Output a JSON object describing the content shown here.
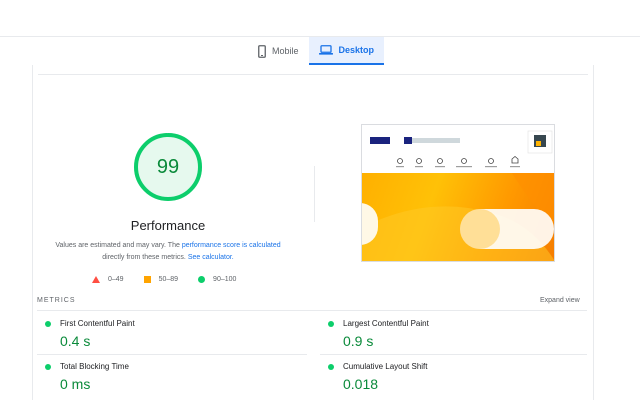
{
  "tabs": [
    {
      "label": "Mobile",
      "active": false,
      "icon": "phone-icon"
    },
    {
      "label": "Desktop",
      "active": true,
      "icon": "laptop-icon"
    }
  ],
  "performance": {
    "score": "99",
    "score_fraction": 0.99,
    "title": "Performance",
    "note_prefix": "Values are estimated and may vary. The ",
    "note_link1": "performance score is calculated",
    "note_middle": " directly from these metrics. ",
    "note_link2": "See calculator."
  },
  "legend": [
    {
      "label": "0–49",
      "icon": "red-triangle-icon",
      "color": "#ff4e42"
    },
    {
      "label": "50–89",
      "icon": "orange-square-icon",
      "color": "#ffa400"
    },
    {
      "label": "90–100",
      "icon": "green-circle-icon",
      "color": "#0cce6b"
    }
  ],
  "metrics_header": {
    "label": "METRICS",
    "expand": "Expand view"
  },
  "metrics": [
    {
      "name": "First Contentful Paint",
      "value": "0.4 s"
    },
    {
      "name": "Largest Contentful Paint",
      "value": "0.9 s"
    },
    {
      "name": "Total Blocking Time",
      "value": "0 ms"
    },
    {
      "name": "Cumulative Layout Shift",
      "value": "0.018"
    }
  ],
  "colors": {
    "pass": "#0cce6b",
    "pass_text": "#0a8a3a",
    "accent": "#1a73e8",
    "hero": "#ffb000"
  }
}
